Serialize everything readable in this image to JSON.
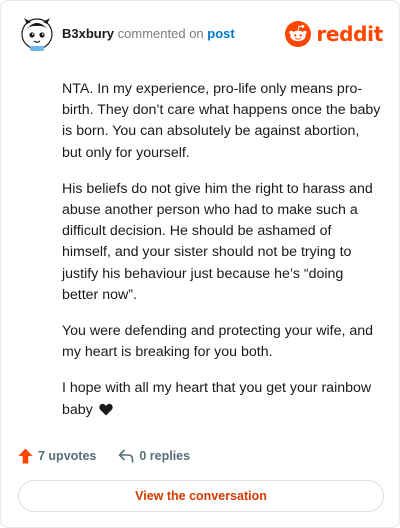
{
  "header": {
    "username": "B3xbury",
    "verb": "commented on",
    "target": "post",
    "brand": "reddit"
  },
  "comment": {
    "paragraphs": [
      "NTA. In my experience, pro-life only means pro-birth. They don’t care what happens once the baby is born. You can absolutely be against abortion, but only for yourself.",
      "His beliefs do not give him the right to harass and abuse another person who had to make such a difficult decision. He should be ashamed of himself, and your sister should not be trying to justify his behaviour just because he’s “doing better now”.",
      "You were defending and protecting your wife, and my heart is breaking for you both.",
      "I hope with all my heart that you get your rainbow baby"
    ],
    "emoji": "black-heart-emoji"
  },
  "footer": {
    "upvotes": "7 upvotes",
    "replies": "0 replies",
    "cta": "View the conversation"
  },
  "colors": {
    "brand": "#ff4500",
    "upvote": "#ff4500",
    "link": "#0079d3",
    "cta_text": "#d93a00",
    "meta": "#576f76"
  },
  "icons": [
    "avatar-icon",
    "reddit-logo-icon",
    "upvote-arrow-icon",
    "reply-arrow-icon",
    "black-heart-icon"
  ]
}
